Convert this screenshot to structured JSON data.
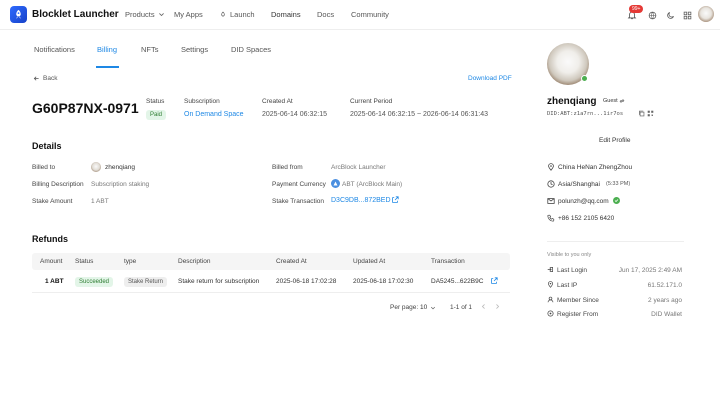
{
  "header": {
    "brand": "Blocklet Launcher",
    "nav": [
      {
        "label": "Products"
      },
      {
        "label": "My Apps"
      },
      {
        "label": "Launch"
      },
      {
        "label": "Domains"
      },
      {
        "label": "Docs"
      },
      {
        "label": "Community"
      }
    ],
    "notification_count": "99+"
  },
  "tabs": [
    {
      "label": "Notifications"
    },
    {
      "label": "Billing"
    },
    {
      "label": "NFTs"
    },
    {
      "label": "Settings"
    },
    {
      "label": "DID Spaces"
    }
  ],
  "back_label": "Back",
  "download_label": "Download PDF",
  "invoice": {
    "id": "G60P87NX-0971",
    "status_label": "Status",
    "status": "Paid",
    "subscription_label": "Subscription",
    "subscription": "On Demand Space",
    "created_label": "Created At",
    "created": "2025-06-14 06:32:15",
    "period_label": "Current Period",
    "period": "2025-06-14 06:32:15 ~ 2026-06-14 06:31:43"
  },
  "details": {
    "title": "Details",
    "billed_to_label": "Billed to",
    "billed_to": "zhenqiang",
    "billing_desc_label": "Billing Description",
    "billing_desc": "Subscription staking",
    "stake_amount_label": "Stake Amount",
    "stake_amount": "1 ABT",
    "billed_from_label": "Billed from",
    "billed_from": "ArcBlock Launcher",
    "currency_label": "Payment Currency",
    "currency": "ABT (ArcBlock Main)",
    "stake_tx_label": "Stake Transaction",
    "stake_tx": "D3C9DB...872BED"
  },
  "refunds": {
    "title": "Refunds",
    "columns": [
      "Amount",
      "Status",
      "type",
      "Description",
      "Created At",
      "Updated At",
      "Transaction"
    ],
    "rows": [
      {
        "amount": "1 ABT",
        "status": "Succeeded",
        "type": "Stake Return",
        "description": "Stake return for subscription",
        "created": "2025-06-18 17:02:28",
        "updated": "2025-06-18 17:02:30",
        "transaction": "DA5245...622B9C"
      }
    ],
    "per_page_label": "Per page:",
    "per_page": "10",
    "range": "1-1 of 1"
  },
  "profile": {
    "name": "zhenqiang",
    "role": "Guest",
    "did": "DID:ABT:z1a7rn...1ir7os",
    "edit_label": "Edit Profile",
    "location": "China HeNan ZhengZhou",
    "timezone": "Asia/Shanghai",
    "local_time": "(5:33 PM)",
    "email": "polunzh@qq.com",
    "phone": "+86 152 2105 6420",
    "visible_note": "Visible to you only",
    "last_login_label": "Last Login",
    "last_login": "Jun 17, 2025 2:49 AM",
    "last_ip_label": "Last IP",
    "last_ip": "61.52.171.0",
    "member_since_label": "Member Since",
    "member_since": "2 years ago",
    "register_from_label": "Register From",
    "register_from": "DID Wallet"
  },
  "colors": {
    "accent": "#1e88e5",
    "success": "#2e7d32",
    "badge": "#e53935"
  }
}
